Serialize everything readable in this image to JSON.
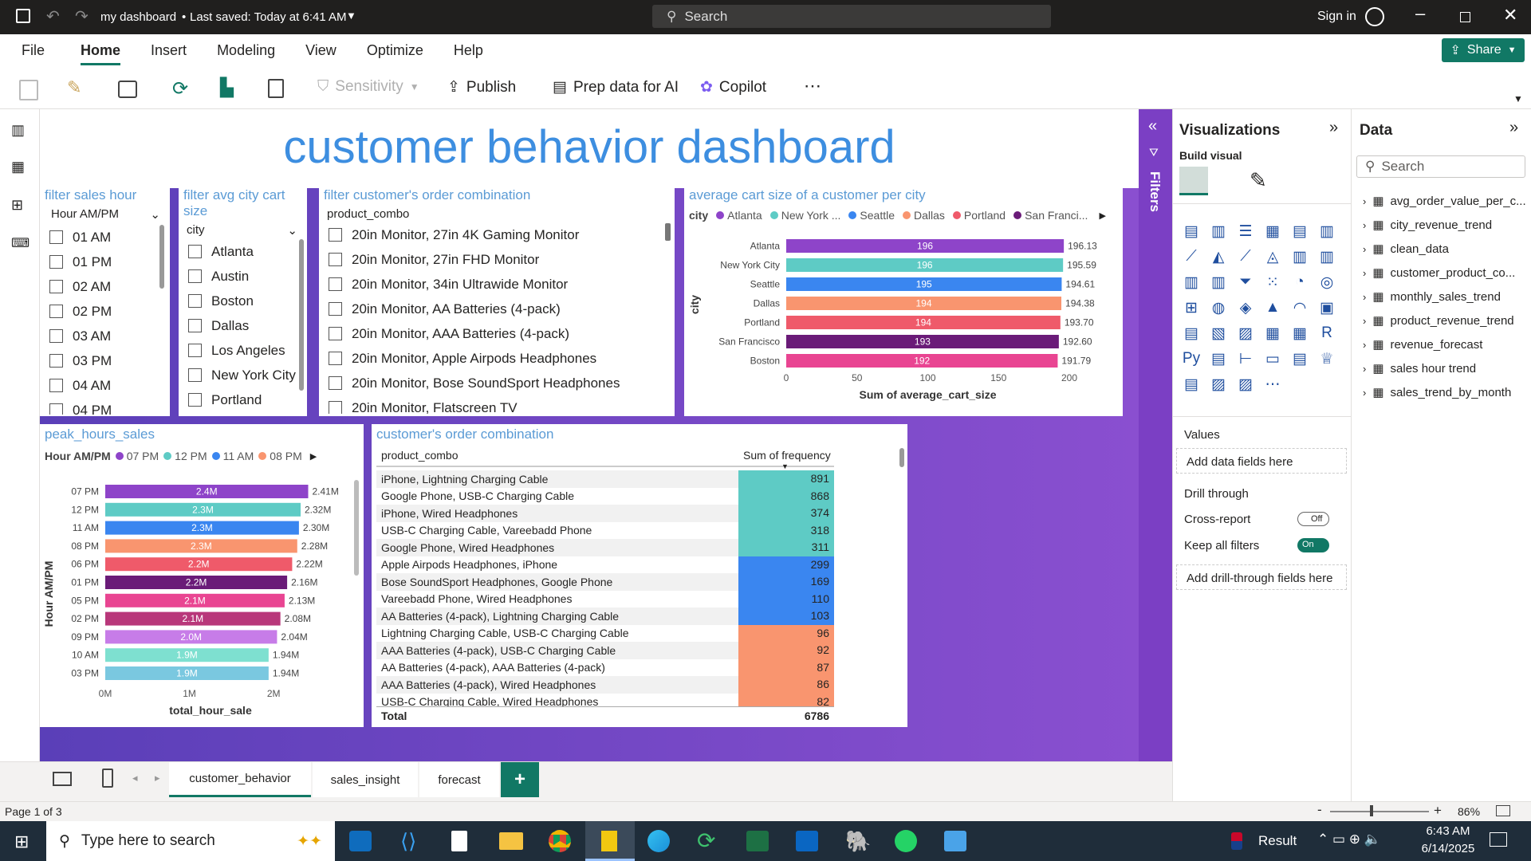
{
  "titlebar": {
    "doc": "my dashboard",
    "saved": "Last saved: Today at 6:41 AM",
    "search": "Search",
    "signin": "Sign in"
  },
  "menu": [
    "File",
    "Home",
    "Insert",
    "Modeling",
    "View",
    "Optimize",
    "Help"
  ],
  "share": "Share",
  "ribbon": {
    "sensitivity": "Sensitivity",
    "publish": "Publish",
    "prep": "Prep data for AI",
    "copilot": "Copilot",
    "more": "⋯"
  },
  "dashboard_title": "customer behavior dashboard",
  "slicer_hour": {
    "title": "filter sales hour",
    "header": "Hour AM/PM",
    "items": [
      "01 AM",
      "01 PM",
      "02 AM",
      "02 PM",
      "03 AM",
      "03 PM",
      "04 AM",
      "04 PM"
    ]
  },
  "slicer_city": {
    "title": "filter avg city cart size",
    "header": "city",
    "items": [
      "Atlanta",
      "Austin",
      "Boston",
      "Dallas",
      "Los Angeles",
      "New York City",
      "Portland"
    ]
  },
  "slicer_combo": {
    "title": "filter customer's order combination",
    "header": "product_combo",
    "items": [
      "20in Monitor, 27in 4K Gaming Monitor",
      "20in Monitor, 27in FHD Monitor",
      "20in Monitor, 34in Ultrawide Monitor",
      "20in Monitor, AA Batteries (4-pack)",
      "20in Monitor, AAA Batteries (4-pack)",
      "20in Monitor, Apple Airpods Headphones",
      "20in Monitor, Bose SoundSport Headphones",
      "20in Monitor, Flatscreen TV"
    ]
  },
  "city_chart": {
    "title": "average cart size of a customer per city",
    "legend_title": "city",
    "legend": [
      "Atlanta",
      "New York ...",
      "Seattle",
      "Dallas",
      "Portland",
      "San Franci..."
    ],
    "xlabel": "Sum of average_cart_size",
    "ylabel": "city",
    "ticks": [
      "0",
      "50",
      "100",
      "150",
      "200"
    ]
  },
  "hour_chart": {
    "title": "peak_hours_sales",
    "legend_title": "Hour AM/PM",
    "legend": [
      "07 PM",
      "12 PM",
      "11 AM",
      "08 PM"
    ],
    "xlabel": "total_hour_sale",
    "ylabel": "Hour AM/PM",
    "ticks": [
      "0M",
      "1M",
      "2M"
    ]
  },
  "combo_table": {
    "title": "customer's order combination",
    "col1": "product_combo",
    "col2": "Sum of frequency",
    "total_label": "Total",
    "total": "6786",
    "rows": [
      [
        "iPhone, Lightning Charging Cable",
        "891"
      ],
      [
        "Google Phone, USB-C Charging Cable",
        "868"
      ],
      [
        "iPhone, Wired Headphones",
        "374"
      ],
      [
        "USB-C Charging Cable, Vareebadd Phone",
        "318"
      ],
      [
        "Google Phone, Wired Headphones",
        "311"
      ],
      [
        "Apple Airpods Headphones, iPhone",
        "299"
      ],
      [
        "Bose SoundSport Headphones, Google Phone",
        "169"
      ],
      [
        "Vareebadd Phone, Wired Headphones",
        "110"
      ],
      [
        "AA Batteries (4-pack), Lightning Charging Cable",
        "103"
      ],
      [
        "Lightning Charging Cable, USB-C Charging Cable",
        "96"
      ],
      [
        "AAA Batteries (4-pack), USB-C Charging Cable",
        "92"
      ],
      [
        "AA Batteries (4-pack), AAA Batteries (4-pack)",
        "87"
      ],
      [
        "AAA Batteries (4-pack), Wired Headphones",
        "86"
      ],
      [
        "USB-C Charging Cable, Wired Headphones",
        "82"
      ]
    ]
  },
  "chart_data": [
    {
      "type": "bar",
      "title": "average cart size of a customer per city",
      "xlabel": "Sum of average_cart_size",
      "ylabel": "city",
      "xlim": [
        0,
        200
      ],
      "categories": [
        "Atlanta",
        "New York City",
        "Seattle",
        "Dallas",
        "Portland",
        "San Francisco",
        "Boston"
      ],
      "values": [
        196.13,
        195.59,
        194.61,
        194.38,
        193.7,
        192.6,
        191.79
      ],
      "inner_labels": [
        "196",
        "196",
        "195",
        "194",
        "194",
        "193",
        "192"
      ],
      "end_labels": [
        "196.13",
        "195.59",
        "194.61",
        "194.38",
        "193.70",
        "192.60",
        "191.79"
      ],
      "colors": [
        "#8e44c9",
        "#5ecbc5",
        "#3a86f0",
        "#f9956f",
        "#ef5a6a",
        "#6a1b78",
        "#e94592"
      ]
    },
    {
      "type": "bar",
      "title": "peak_hours_sales",
      "xlabel": "total_hour_sale",
      "ylabel": "Hour AM/PM",
      "xlim": [
        0,
        2500000
      ],
      "categories": [
        "07 PM",
        "12 PM",
        "11 AM",
        "08 PM",
        "06 PM",
        "01 PM",
        "05 PM",
        "02 PM",
        "09 PM",
        "10 AM",
        "03 PM"
      ],
      "values": [
        2410000,
        2320000,
        2300000,
        2280000,
        2220000,
        2160000,
        2130000,
        2080000,
        2040000,
        1940000,
        1940000
      ],
      "inner_labels": [
        "2.4M",
        "2.3M",
        "2.3M",
        "2.3M",
        "2.2M",
        "2.2M",
        "2.1M",
        "2.1M",
        "2.0M",
        "1.9M",
        "1.9M"
      ],
      "end_labels": [
        "2.41M",
        "2.32M",
        "2.30M",
        "2.28M",
        "2.22M",
        "2.16M",
        "2.13M",
        "2.08M",
        "2.04M",
        "1.94M",
        "1.94M"
      ],
      "colors": [
        "#8e44c9",
        "#5ecbc5",
        "#3a86f0",
        "#f9956f",
        "#ef5a6a",
        "#6a1b78",
        "#e94592",
        "#b8377a",
        "#c77ce8",
        "#7ee0d0",
        "#7ac8e0"
      ]
    },
    {
      "type": "table",
      "columns": [
        "product_combo",
        "Sum of frequency"
      ],
      "total": 6786
    }
  ],
  "viz": {
    "title": "Visualizations",
    "build": "Build visual",
    "values": "Values",
    "add_data": "Add data fields here",
    "drill": "Drill through",
    "cross": "Cross-report",
    "cross_state": "Off",
    "keep": "Keep all filters",
    "keep_state": "On",
    "add_drill": "Add drill-through fields here"
  },
  "filters_label": "Filters",
  "data_panel": {
    "title": "Data",
    "search": "Search",
    "tables": [
      "avg_order_value_per_c...",
      "city_revenue_trend",
      "clean_data",
      "customer_product_co...",
      "monthly_sales_trend",
      "product_revenue_trend",
      "revenue_forecast",
      "sales hour trend",
      "sales_trend_by_month"
    ]
  },
  "tabs": [
    "customer_behavior",
    "sales_insight",
    "forecast"
  ],
  "status": {
    "page": "Page 1 of 3",
    "zoom": "86%"
  },
  "taskbar": {
    "search": "Type here to search",
    "result": "Result",
    "time": "6:43 AM",
    "date": "6/14/2025"
  }
}
